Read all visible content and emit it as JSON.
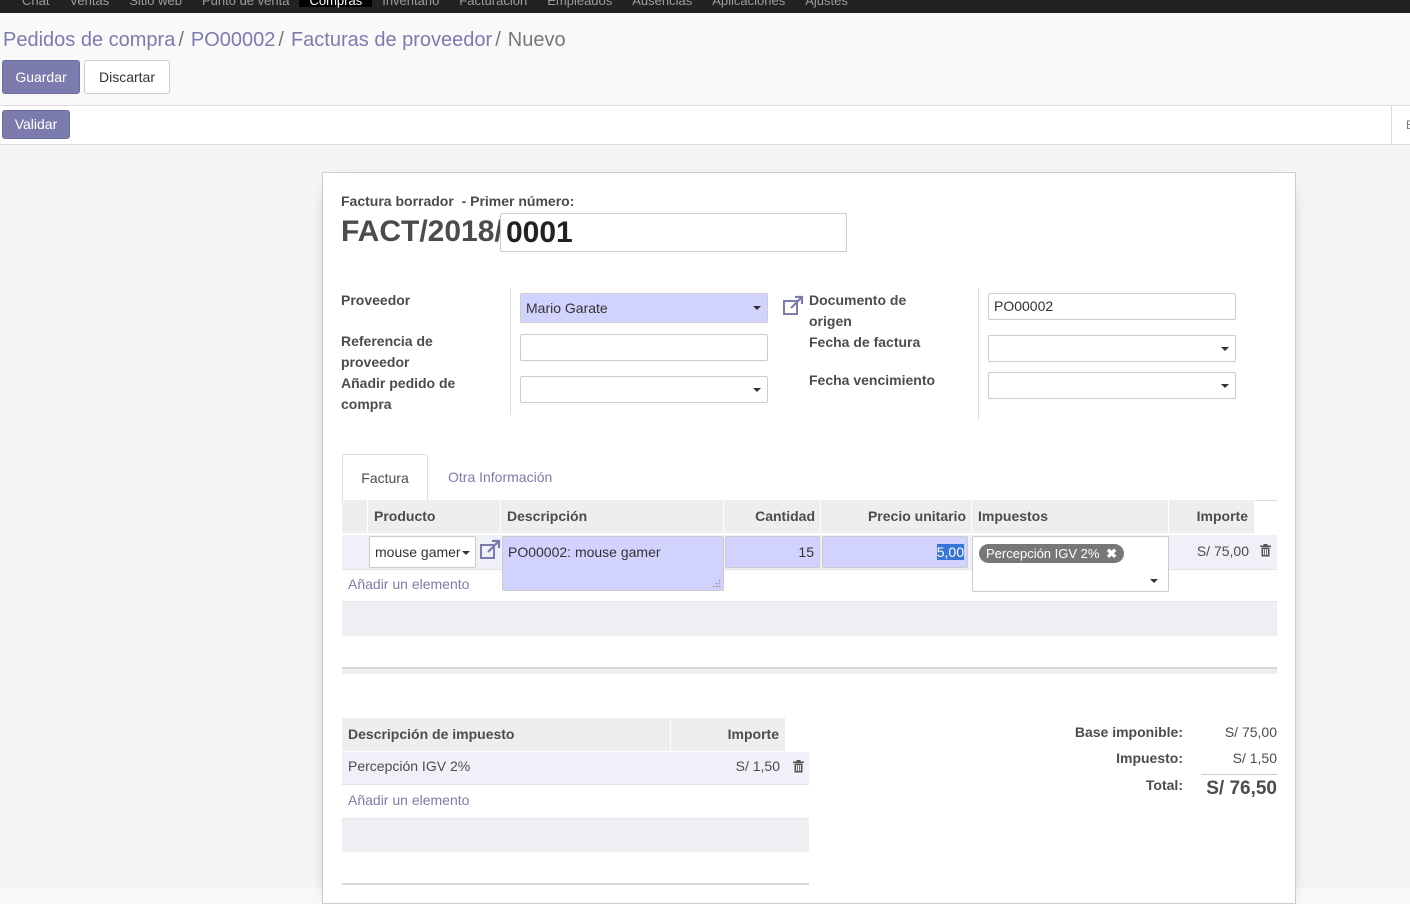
{
  "top_menu": [
    "Chat",
    "Ventas",
    "Sitio web",
    "Punto de venta",
    "Compras",
    "Inventario",
    "Facturación",
    "Empleados",
    "Ausencias",
    "Aplicaciones",
    "Ajustes"
  ],
  "top_menu_active": "Compras",
  "breadcrumb": {
    "items": [
      "Pedidos de compra",
      "PO00002",
      "Facturas de proveedor"
    ],
    "current": "Nuevo",
    "separator": "/"
  },
  "buttons": {
    "save": "Guardar",
    "discard": "Discartar",
    "validate": "Validar"
  },
  "invoice": {
    "header_label": "Factura borrador  - Primer número:",
    "prefix": "FACT/2018/",
    "number": "0001"
  },
  "form": {
    "vendor_label": "Proveedor",
    "vendor_value": "Mario Garate",
    "vendor_ref_label": "Referencia de proveedor",
    "vendor_ref_value": "",
    "add_po_label": "Añadir pedido de compra",
    "add_po_value": "",
    "source_doc_label": "Documento de origen",
    "source_doc_value": "PO00002",
    "invoice_date_label": "Fecha de factura",
    "invoice_date_value": "",
    "due_date_label": "Fecha vencimiento",
    "due_date_value": ""
  },
  "tabs": [
    "Factura",
    "Otra Información"
  ],
  "lines": {
    "headers": {
      "product": "Producto",
      "description": "Descripción",
      "quantity": "Cantidad",
      "unit_price": "Precio unitario",
      "taxes": "Impuestos",
      "amount": "Importe"
    },
    "row": {
      "product": "mouse gamer",
      "description": "PO00002: mouse gamer",
      "quantity": "15",
      "unit_price": "5,00",
      "tax_tag": "Percepción IGV 2%",
      "amount": "S/ 75,00"
    },
    "add_item": "Añadir un elemento"
  },
  "tax_table": {
    "headers": {
      "description": "Descripción de impuesto",
      "amount": "Importe"
    },
    "row": {
      "description": "Percepción IGV 2%",
      "amount": "S/ 1,50"
    },
    "add_item": "Añadir un elemento"
  },
  "totals": {
    "base_label": "Base imponible:",
    "base_value": "S/ 75,00",
    "tax_label": "Impuesto:",
    "tax_value": "S/ 1,50",
    "total_label": "Total:",
    "total_value": "S/ 76,50"
  },
  "colors": {
    "brand": "#7c7bad",
    "required_field": "#d2d2ff",
    "topbar": "#222222"
  }
}
